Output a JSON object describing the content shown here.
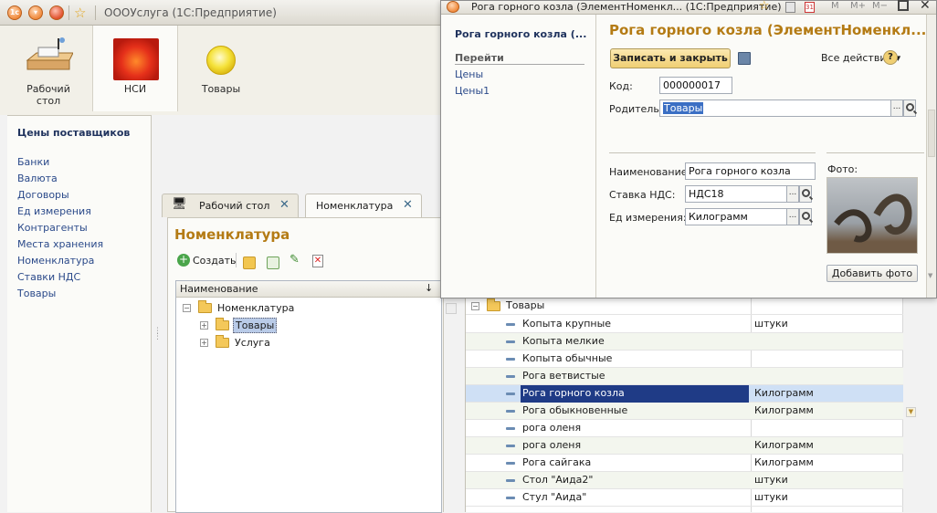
{
  "app": {
    "title": "ОООУслуга  (1С:Предприятие)"
  },
  "sections": [
    {
      "label": "Рабочий стол",
      "icon": "desktop-icon"
    },
    {
      "label": "НСИ",
      "icon": "flower-icon"
    },
    {
      "label": "Товары",
      "icon": "yellow-ball-icon"
    }
  ],
  "nav": {
    "heading": "Цены поставщиков",
    "items": [
      "Банки",
      "Валюта",
      "Договоры",
      "Ед измерения",
      "Контрагенты",
      "Места хранения",
      "Номенклатура",
      "Ставки НДС",
      "Товары"
    ]
  },
  "tabs": [
    {
      "label": "Рабочий стол"
    },
    {
      "label": "Номенклатура"
    }
  ],
  "form": {
    "title": "Номенклатура",
    "create_label": "Создать",
    "column_header": "Наименование",
    "tree": [
      {
        "label": "Номенклатура",
        "level": 0,
        "expander": "−"
      },
      {
        "label": "Товары",
        "level": 1,
        "expander": "+",
        "selected": true
      },
      {
        "label": "Услуга",
        "level": 1,
        "expander": "+"
      }
    ]
  },
  "list": {
    "group_label": "Товары",
    "rows": [
      {
        "name": "Копыта крупные",
        "unit": "штуки"
      },
      {
        "name": "Копыта мелкие",
        "unit": ""
      },
      {
        "name": "Копыта обычные",
        "unit": ""
      },
      {
        "name": "Рога ветвистые",
        "unit": ""
      },
      {
        "name": "Рога горного козла",
        "unit": "Килограмм",
        "selected": true
      },
      {
        "name": "Рога обыкновенные",
        "unit": "Килограмм"
      },
      {
        "name": "рога оленя",
        "unit": ""
      },
      {
        "name": "рога оленя",
        "unit": "Килограмм"
      },
      {
        "name": "Рога сайгака",
        "unit": "Килограмм"
      },
      {
        "name": "Стол \"Аида2\"",
        "unit": "штуки"
      },
      {
        "name": "Стул \"Аида\"",
        "unit": "штуки"
      }
    ]
  },
  "dialog": {
    "title": "Рога горного козла (ЭлементНоменкл...  (1С:Предприятие)",
    "nav_name": "Рога горного козла (...",
    "nav_goto": "Перейти",
    "nav_links": [
      "Цены",
      "Цены1"
    ],
    "heading": "Рога горного козла (ЭлементНоменкл...",
    "save_close": "Записать и закрыть",
    "all_actions": "Все действия ▾",
    "help": "?",
    "code_label": "Код:",
    "code_value": "000000017",
    "parent_label": "Родитель:",
    "parent_value": "Товары",
    "name_label": "Наименование:",
    "name_value": "Рога горного козла",
    "vat_label": "Ставка НДС:",
    "vat_value": "НДС18",
    "unit_label": "Ед измерения:",
    "unit_value": "Килограмм",
    "photo_label": "Фото:",
    "add_photo": "Добавить фото",
    "toolbar_m": "M",
    "toolbar_mplus": "M+",
    "toolbar_mminus": "M−"
  }
}
